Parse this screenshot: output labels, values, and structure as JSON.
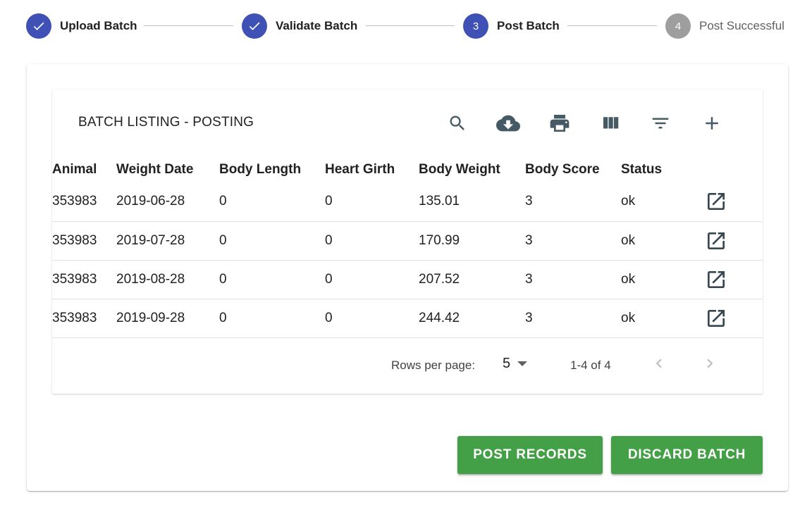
{
  "stepper": {
    "steps": [
      {
        "label": "Upload Batch",
        "number": "",
        "state": "completed"
      },
      {
        "label": "Validate Batch",
        "number": "",
        "state": "completed"
      },
      {
        "label": "Post Batch",
        "number": "3",
        "state": "active"
      },
      {
        "label": "Post Successful",
        "number": "4",
        "state": "pending"
      }
    ]
  },
  "table_section": {
    "title": "BATCH LISTING - POSTING",
    "toolbar_icons": [
      "search-icon",
      "cloud-download-icon",
      "print-icon",
      "view-columns-icon",
      "filter-list-icon",
      "add-icon"
    ],
    "columns": [
      "Animal",
      "Weight Date",
      "Body Length",
      "Heart Girth",
      "Body Weight",
      "Body Score",
      "Status"
    ],
    "rows": [
      [
        "353983",
        "2019-06-28",
        "0",
        "0",
        "135.01",
        "3",
        "ok"
      ],
      [
        "353983",
        "2019-07-28",
        "0",
        "0",
        "170.99",
        "3",
        "ok"
      ],
      [
        "353983",
        "2019-08-28",
        "0",
        "0",
        "207.52",
        "3",
        "ok"
      ],
      [
        "353983",
        "2019-09-28",
        "0",
        "0",
        "244.42",
        "3",
        "ok"
      ]
    ],
    "row_action_icon": "open-in-new-icon"
  },
  "pagination": {
    "rows_per_page_label": "Rows per page:",
    "rows_per_page_value": "5",
    "range_text": "1-4 of 4"
  },
  "actions": {
    "post_label": "POST RECORDS",
    "discard_label": "DISCARD BATCH"
  },
  "colors": {
    "primary": "#3f51b5",
    "inactive_step": "#9e9e9e",
    "action_button": "#43a047",
    "icon": "#455a64"
  }
}
